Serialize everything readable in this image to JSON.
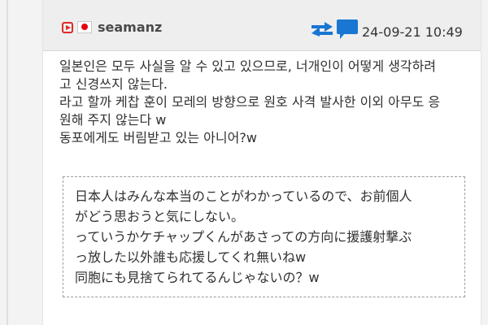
{
  "post": {
    "username": "seamanz",
    "timestamp": "24-09-21 10:49",
    "body_lines": [
      "일본인은 모두 사실을 알 수 있고 있으므로, 너개인이 어떻게 생각하려",
      "고 신경쓰지 않는다.",
      "라고 할까 케찹 훈이 모레의 방향으로 원호 사격 발사한 이외 아무도 응",
      "원해 주지 않는다 w",
      "동포에게도 버림받고 있는 아니어?w"
    ],
    "quote_lines": [
      "日本人はみんな本当のことがわかっているので、お前個人",
      "がどう思おうと気にしない。",
      "っていうかケチャップくんがあさっての方向に援護射撃ぶ",
      "っ放した以外誰も応援してくれ無いねw",
      "同胞にも見捨てられてるんじゃないの？w"
    ]
  },
  "icons": {
    "source": "video-play-icon",
    "flag": "japan-flag-icon",
    "translate": "swap-arrows-icon",
    "comment": "comment-icon"
  },
  "colors": {
    "accent_blue": "#1976d2",
    "video_red": "#e02a2a",
    "flag_red": "#e60012"
  }
}
